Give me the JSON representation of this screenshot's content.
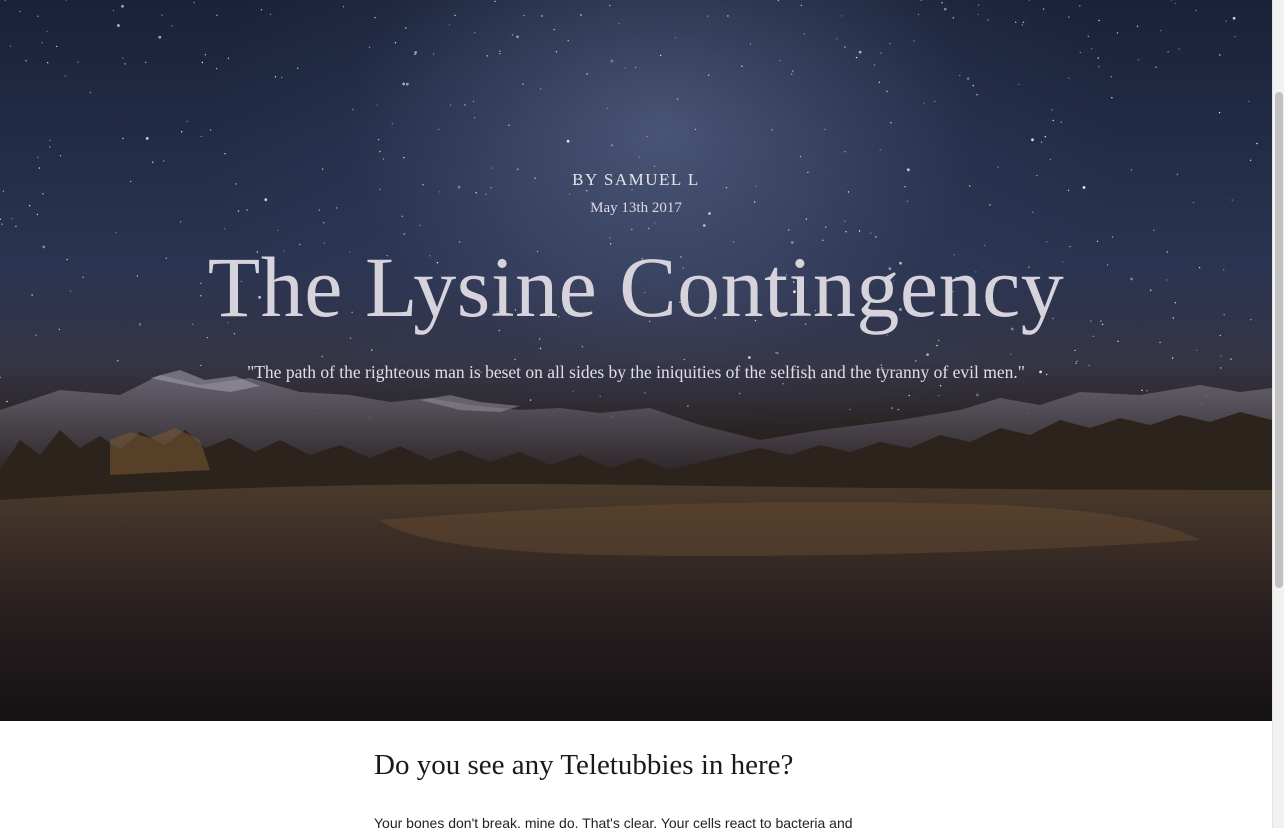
{
  "hero": {
    "byline": "BY SAMUEL L",
    "date": "May 13th 2017",
    "title": "The Lysine Contingency",
    "quote": "\"The path of the righteous man is beset on all sides by the iniquities of the selfish and the tyranny of evil men.\""
  },
  "article": {
    "heading": "Do you see any Teletubbies in here?",
    "body": "Your bones don't break, mine do. That's clear. Your cells react to bacteria and"
  },
  "colors": {
    "sky": "#232c47",
    "ground": "#141114",
    "hero_text": "#e9e6ee",
    "article_heading": "#1a1a1a"
  }
}
